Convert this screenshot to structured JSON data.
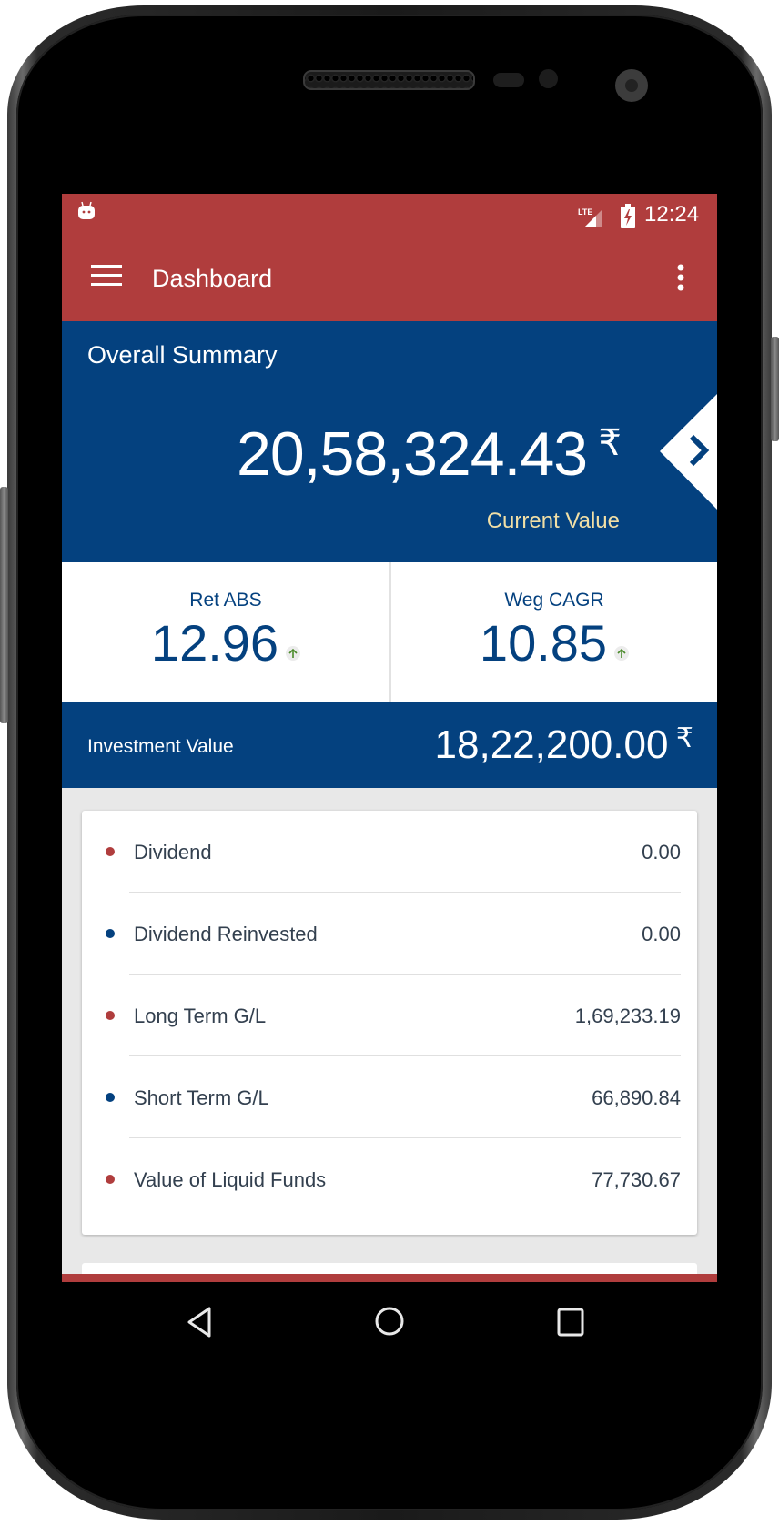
{
  "status_bar": {
    "time": "12:24",
    "network_label": "LTE",
    "icons": [
      "android-notification-icon",
      "lte-signal-icon",
      "battery-charging-icon"
    ]
  },
  "app_bar": {
    "title": "Dashboard",
    "menu_icon": "hamburger-menu-icon",
    "overflow_icon": "more-vert-icon"
  },
  "summary": {
    "heading": "Overall Summary",
    "current_value": "20,58,324.43",
    "currency_symbol": "₹",
    "current_value_label": "Current Value",
    "next_icon": "chevron-right-icon"
  },
  "stats": [
    {
      "label": "Ret ABS",
      "value": "12.96",
      "trend": "up"
    },
    {
      "label": "Weg CAGR",
      "value": "10.85",
      "trend": "up"
    }
  ],
  "investment": {
    "label": "Investment Value",
    "value": "18,22,200.00",
    "currency_symbol": "₹"
  },
  "breakdown": [
    {
      "label": "Dividend",
      "value": "0.00",
      "bullet_color": "#b03d3d"
    },
    {
      "label": "Dividend Reinvested",
      "value": "0.00",
      "bullet_color": "#04417f"
    },
    {
      "label": "Long Term G/L",
      "value": "1,69,233.19",
      "bullet_color": "#b03d3d"
    },
    {
      "label": "Short Term G/L",
      "value": "66,890.84",
      "bullet_color": "#04417f"
    },
    {
      "label": "Value of Liquid Funds",
      "value": "77,730.67",
      "bullet_color": "#b03d3d"
    }
  ],
  "nav_bar": {
    "back": "back-icon",
    "home": "home-icon",
    "recents": "recents-icon"
  },
  "colors": {
    "primary_red": "#b03d3d",
    "primary_blue": "#04417f",
    "accent_beige": "#f1dfa6",
    "trend_green": "#4a8a2a"
  }
}
